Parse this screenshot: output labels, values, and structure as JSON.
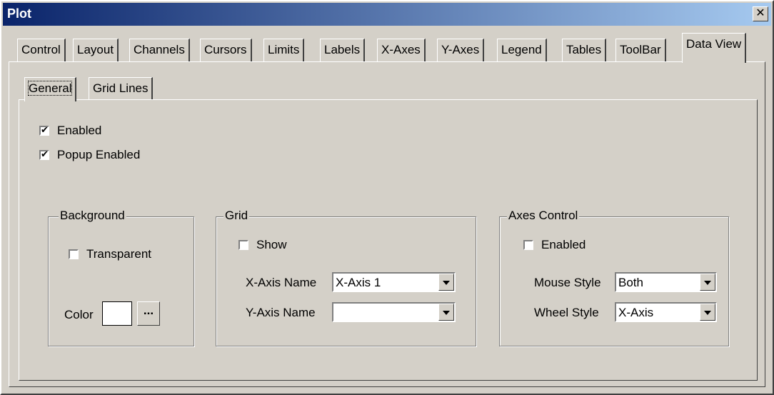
{
  "window": {
    "title": "Plot",
    "close_glyph": "✕"
  },
  "tabs": [
    "Control",
    "Layout",
    "Channels",
    "Cursors",
    "Limits",
    "Labels",
    "X-Axes",
    "Y-Axes",
    "Legend",
    "Tables",
    "ToolBar",
    "Data View"
  ],
  "active_tab": "Data View",
  "subtabs": [
    "General",
    "Grid Lines"
  ],
  "active_subtab": "General",
  "general": {
    "enabled": {
      "label": "Enabled",
      "checked": true
    },
    "popup_enabled": {
      "label": "Popup Enabled",
      "checked": true
    }
  },
  "background": {
    "title": "Background",
    "transparent": {
      "label": "Transparent",
      "checked": false
    },
    "color_label": "Color",
    "color_value": "#ffffff",
    "browse_label": "..."
  },
  "grid": {
    "title": "Grid",
    "show": {
      "label": "Show",
      "checked": false
    },
    "x_axis_name_label": "X-Axis Name",
    "x_axis_name_value": "X-Axis 1",
    "y_axis_name_label": "Y-Axis Name",
    "y_axis_name_value": ""
  },
  "axes_control": {
    "title": "Axes Control",
    "enabled": {
      "label": "Enabled",
      "checked": false
    },
    "mouse_style_label": "Mouse Style",
    "mouse_style_value": "Both",
    "wheel_style_label": "Wheel Style",
    "wheel_style_value": "X-Axis"
  }
}
